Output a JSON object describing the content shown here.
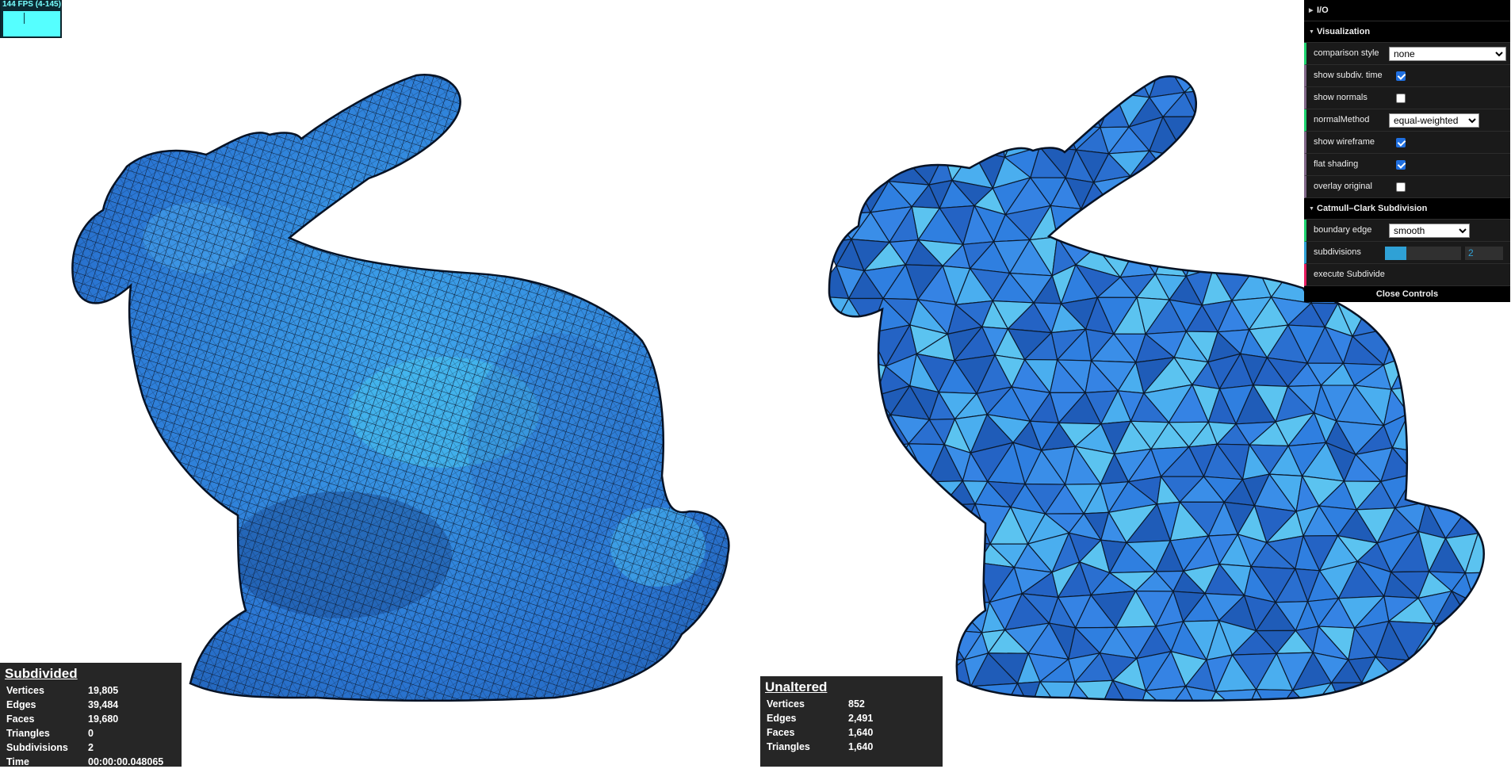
{
  "fps": {
    "text": "144 FPS (4-145)"
  },
  "colors": {
    "mesh_base": "#2f7fe0",
    "mesh_dark": "#1b4f9a",
    "mesh_light": "#4fc8ef",
    "wire": "#0b1a2e",
    "gui_bg": "#1a1a1a",
    "stats_bg": "#262626"
  },
  "left_stats": {
    "title": "Subdivided",
    "rows": [
      {
        "label": "Vertices",
        "value": "19,805"
      },
      {
        "label": "Edges",
        "value": "39,484"
      },
      {
        "label": "Faces",
        "value": "19,680"
      },
      {
        "label": "Triangles",
        "value": "0"
      },
      {
        "label": "Subdivisions",
        "value": "2"
      },
      {
        "label": "Time",
        "value": "00:00:00.048065"
      }
    ]
  },
  "right_stats": {
    "title": "Unaltered",
    "rows": [
      {
        "label": "Vertices",
        "value": "852"
      },
      {
        "label": "Edges",
        "value": "2,491"
      },
      {
        "label": "Faces",
        "value": "1,640"
      },
      {
        "label": "Triangles",
        "value": "1,640"
      }
    ]
  },
  "gui": {
    "io_folder": "I/O",
    "vis_folder": "Visualization",
    "comparison_style": {
      "label": "comparison style",
      "value": "none"
    },
    "show_subdiv_time": {
      "label": "show subdiv. time",
      "checked": true
    },
    "show_normals": {
      "label": "show normals",
      "checked": false
    },
    "normal_method": {
      "label": "normalMethod",
      "value": "equal-weighted"
    },
    "show_wireframe": {
      "label": "show wireframe",
      "checked": true
    },
    "flat_shading": {
      "label": "flat shading",
      "checked": true
    },
    "overlay_original": {
      "label": "overlay original",
      "checked": false
    },
    "cc_folder": "Catmull–Clark Subdivision",
    "boundary_edge": {
      "label": "boundary edge",
      "value": "smooth"
    },
    "subdivisions": {
      "label": "subdivisions",
      "value": "2",
      "fraction": 0.28
    },
    "execute": {
      "label": "execute Subdivide"
    },
    "close": "Close Controls"
  },
  "icons": {
    "fps_graph": "fps-graph",
    "folder_closed": "triangle-right-icon",
    "folder_open": "triangle-down-icon"
  }
}
